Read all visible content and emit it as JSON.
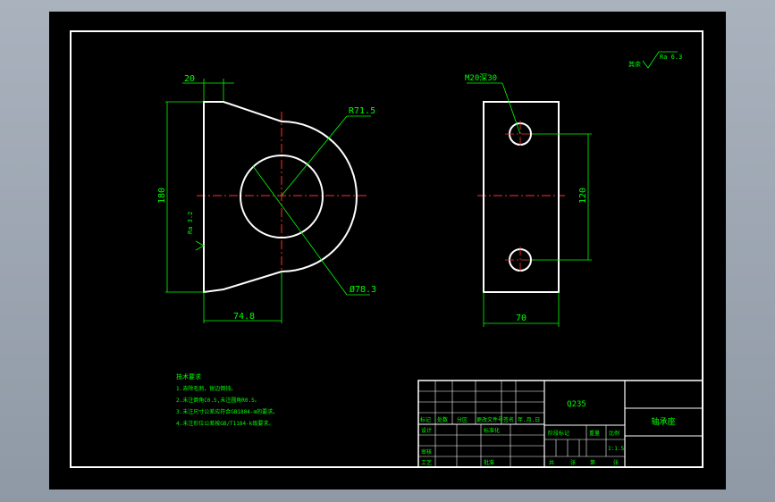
{
  "colors": {
    "background": "#000000",
    "outline": "#ffffff",
    "dimension": "#00ff00",
    "centerline": "#ff3030",
    "workspace": "#a0a9b4"
  },
  "front_view": {
    "dim_top_width": "20",
    "dim_height": "180",
    "dim_radius_outer": "R71.5",
    "dim_hole_diameter": "Ø78.3",
    "dim_bottom_width": "74.8",
    "surface_finish": "Ra 3.2"
  },
  "side_view": {
    "dim_thread": "M20深30",
    "dim_hole_spacing": "120",
    "dim_width": "70"
  },
  "corner_finish": {
    "prefix": "其余",
    "value": "Ra 6.3"
  },
  "tech_notes": {
    "title": "技术要求",
    "lines": [
      "1.去除毛刺，锐边倒钝。",
      "2.未注倒角C0.5,未注圆角R0.5。",
      "3.未注尺寸公差应符合GB1804-m的要求。",
      "4.未注形位公差按GB/T1184-k级要求。"
    ]
  },
  "title_block": {
    "material": "Q235",
    "part_name": "轴承座",
    "row_header": [
      "标记",
      "处数",
      "分区",
      "更改文件号",
      "签名",
      "年.月.日"
    ],
    "design": "设计",
    "standardization": "标准化",
    "review": "审核",
    "process": "工艺",
    "approve": "批准",
    "stage_mark": "阶段标记",
    "weight": "重量",
    "scale": "比例",
    "scale_value": "1:1.5",
    "sheets_total": "共",
    "sheets_label": "张",
    "sheet_no": "第",
    "sheet_label": "张"
  }
}
